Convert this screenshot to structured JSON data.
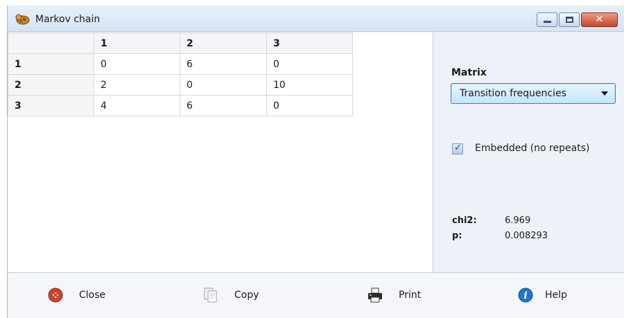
{
  "window": {
    "title": "Markov chain",
    "close_glyph": "✕",
    "icon": "app-icon"
  },
  "table": {
    "headers": [
      "",
      "1",
      "2",
      "3"
    ],
    "rows": [
      [
        "1",
        "0",
        "6",
        "0"
      ],
      [
        "2",
        "2",
        "0",
        "10"
      ],
      [
        "3",
        "4",
        "6",
        "0"
      ]
    ]
  },
  "panel": {
    "matrix_label": "Matrix",
    "matrix_select": "Transition frequencies",
    "embedded_label": "Embedded (no repeats)",
    "embedded_checked": true,
    "stats": [
      {
        "label": "chi2:",
        "value": "6.969"
      },
      {
        "label": "p:",
        "value": "0.008293"
      }
    ]
  },
  "buttons": {
    "close": {
      "label": "Close",
      "icon": "close-icon"
    },
    "copy": {
      "label": "Copy",
      "icon": "copy-icon"
    },
    "print": {
      "label": "Print",
      "icon": "printer-icon"
    },
    "help": {
      "label": "Help",
      "icon": "help-icon"
    }
  },
  "colors": {
    "accent": "#3c7fb1",
    "close_red": "#c9442a",
    "help_blue": "#1e78c8"
  }
}
